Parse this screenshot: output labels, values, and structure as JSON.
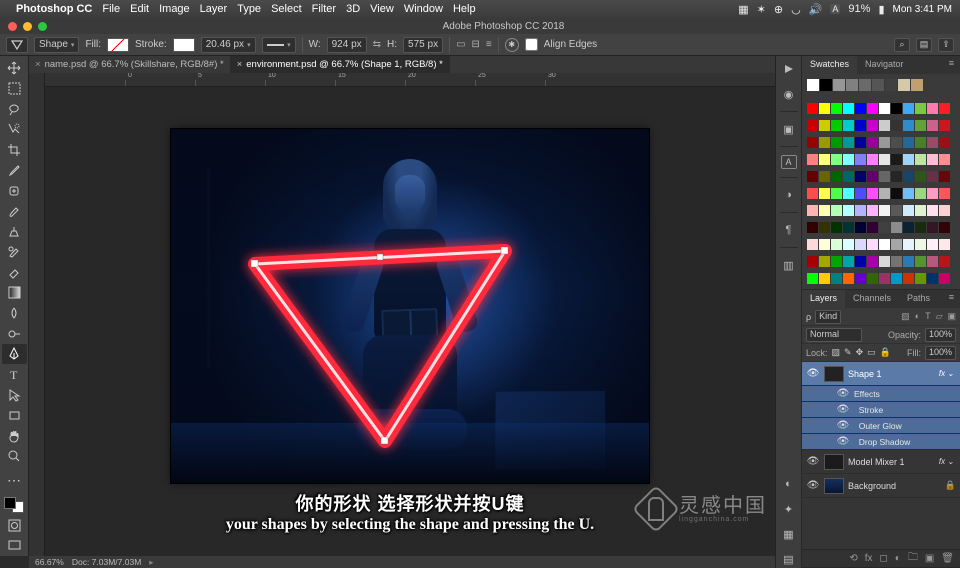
{
  "mac_menubar": {
    "app": "Photoshop CC",
    "items": [
      "File",
      "Edit",
      "Image",
      "Layer",
      "Type",
      "Select",
      "Filter",
      "3D",
      "View",
      "Window",
      "Help"
    ],
    "battery_pct": "91%",
    "clock": "Mon 3:41 PM"
  },
  "window_title": "Adobe Photoshop CC 2018",
  "options_bar": {
    "shape_mode": "Shape",
    "fill_label": "Fill:",
    "stroke_label": "Stroke:",
    "stroke_width": "20.46 px",
    "w_label": "W:",
    "w_value": "924 px",
    "h_label": "H:",
    "h_value": "575 px",
    "align_edges_label": "Align Edges"
  },
  "doc_tabs": [
    {
      "label": "name.psd @ 66.7% (Skillshare, RGB/8#) *",
      "active": false
    },
    {
      "label": "environment.psd @ 66.7% (Shape 1, RGB/8) *",
      "active": true
    }
  ],
  "ruler_ticks": [
    "0",
    "5",
    "10",
    "15",
    "20",
    "25",
    "30"
  ],
  "status_bar": {
    "zoom": "66.67%",
    "doc_size": "Doc: 7.03M/7.03M"
  },
  "subtitles": {
    "cn": "你的形状 选择形状并按U键",
    "en": "your shapes by selecting the shape and pressing the U."
  },
  "watermark": {
    "brand_cn": "灵感中国",
    "brand_en": "lingganchina.com"
  },
  "right_panels": {
    "swatches": {
      "tabs": [
        "Swatches",
        "Navigator"
      ],
      "row1": [
        "#ffffff",
        "#000000",
        "#969696",
        "#808080",
        "#6a6a6a",
        "#555555",
        "#404040",
        "#d4c9a8",
        "#bfa070"
      ],
      "rows": [
        [
          "#ff0000",
          "#ffff00",
          "#00ff00",
          "#00ffff",
          "#0000ff",
          "#ff00ff",
          "#ffffff",
          "#000000",
          "#3fa9f5",
          "#7ac943",
          "#ff7bac",
          "#ff1d25"
        ],
        [
          "#cc0000",
          "#cccc00",
          "#00cc00",
          "#00cccc",
          "#0000cc",
          "#cc00cc",
          "#cccccc",
          "#333333",
          "#2e8bcc",
          "#5fa336",
          "#cc628a",
          "#cc171e"
        ],
        [
          "#990000",
          "#999900",
          "#009900",
          "#009999",
          "#000099",
          "#990099",
          "#999999",
          "#4d4d4d",
          "#226899",
          "#478029",
          "#994a67",
          "#991117"
        ],
        [
          "#ff8080",
          "#ffff80",
          "#80ff80",
          "#80ffff",
          "#8080ff",
          "#ff80ff",
          "#e6e6e6",
          "#1a1a1a",
          "#9fd4fa",
          "#bde4a1",
          "#ffbdd6",
          "#ff8e92"
        ],
        [
          "#660000",
          "#666600",
          "#006600",
          "#006666",
          "#000066",
          "#660066",
          "#666666",
          "#262626",
          "#174566",
          "#2f551b",
          "#663145",
          "#66070c"
        ],
        [
          "#ff4d4d",
          "#ffff4d",
          "#4dff4d",
          "#4dffff",
          "#4d4dff",
          "#ff4dff",
          "#b3b3b3",
          "#0d0d0d",
          "#6fbff7",
          "#9dd680",
          "#ff9cc1",
          "#ff565c"
        ],
        [
          "#ffb3b3",
          "#ffffb3",
          "#b3ffb3",
          "#b3ffff",
          "#b3b3ff",
          "#ffb3ff",
          "#f2f2f2",
          "#595959",
          "#cfeafc",
          "#def1d0",
          "#ffe0ec",
          "#ffd1d3"
        ],
        [
          "#330000",
          "#333300",
          "#003300",
          "#003333",
          "#000033",
          "#330033",
          "#404040",
          "#8c8c8c",
          "#0b2233",
          "#182b0e",
          "#331823",
          "#330406"
        ],
        [
          "#ffd9d9",
          "#ffffd9",
          "#d9ffd9",
          "#d9ffff",
          "#d9d9ff",
          "#ffd9ff",
          "#ffffff",
          "#a6a6a6",
          "#e7f4fd",
          "#eef8e7",
          "#fff0f6",
          "#ffe8e9"
        ],
        [
          "#a60000",
          "#a6a600",
          "#00a600",
          "#00a6a6",
          "#0000a6",
          "#a600a6",
          "#d9d9d9",
          "#737373",
          "#2a7ab8",
          "#539330",
          "#b8587d",
          "#b8151b"
        ],
        [
          "#00ff00",
          "#ffcc00",
          "#008080",
          "#ff6600",
          "#6600cc",
          "#336600",
          "#993366",
          "#0099cc",
          "#cc3300",
          "#669900",
          "#003366",
          "#cc0066"
        ]
      ]
    },
    "layers": {
      "tabs": [
        "Layers",
        "Channels",
        "Paths"
      ],
      "kind_label": "Kind",
      "blend_mode": "Normal",
      "opacity_label": "Opacity:",
      "opacity_value": "100%",
      "lock_label": "Lock:",
      "fill_label": "Fill:",
      "fill_value": "100%",
      "items": [
        {
          "type": "shape",
          "name": "Shape 1",
          "selected": true,
          "fx": true
        },
        {
          "type": "fx-head",
          "name": "Effects"
        },
        {
          "type": "fx",
          "name": "Stroke"
        },
        {
          "type": "fx",
          "name": "Outer Glow"
        },
        {
          "type": "fx",
          "name": "Drop Shadow"
        },
        {
          "type": "smart",
          "name": "Model Mixer 1",
          "selected": false,
          "fx": true
        },
        {
          "type": "bg",
          "name": "Background",
          "locked": true
        }
      ]
    }
  }
}
